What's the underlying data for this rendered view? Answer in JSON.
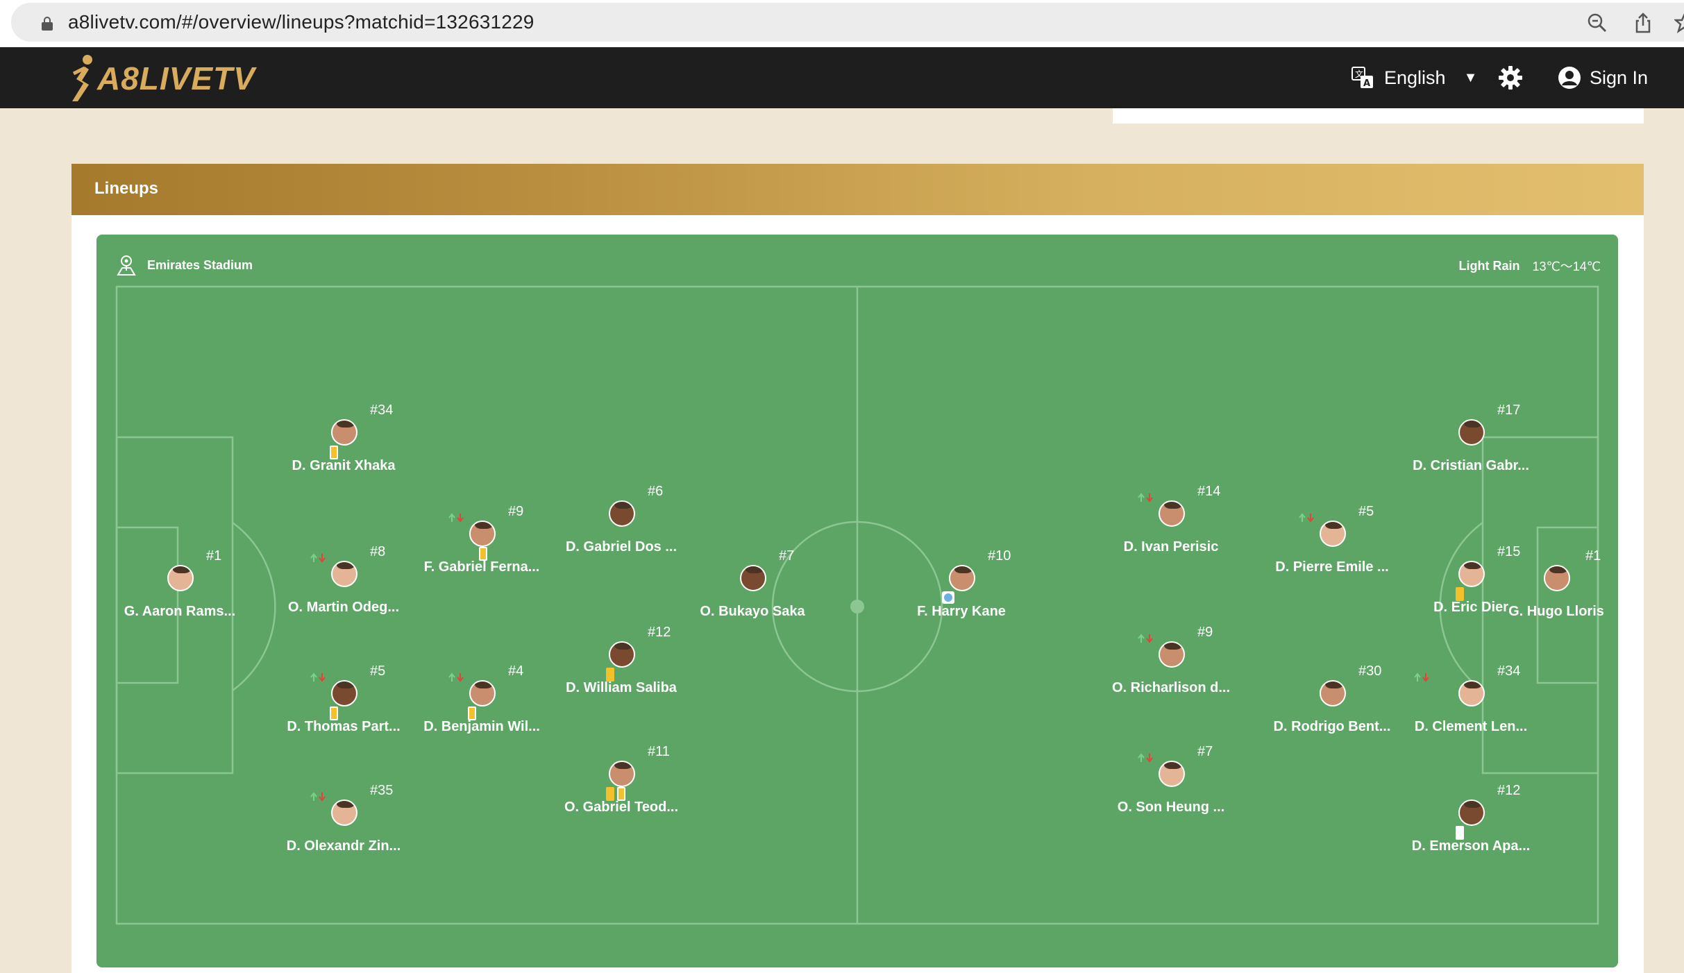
{
  "browser": {
    "url": "a8livetv.com/#/overview/lineups?matchid=132631229"
  },
  "header": {
    "logo_text": "A8LIVETV",
    "language": "English",
    "sign_in": "Sign In"
  },
  "lineups": {
    "title": "Lineups",
    "stadium": "Emirates Stadium",
    "weather": "Light Rain",
    "temperature": "13℃～14℃",
    "home_players": [
      {
        "num": "#1",
        "name": "G. Aaron Rams..."
      },
      {
        "num": "#34",
        "name": "D. Granit Xhaka"
      },
      {
        "num": "#8",
        "name": "O. Martin Odeg..."
      },
      {
        "num": "#5",
        "name": "D. Thomas Part..."
      },
      {
        "num": "#35",
        "name": "D. Olexandr Zin..."
      },
      {
        "num": "#9",
        "name": "F. Gabriel Ferna..."
      },
      {
        "num": "#4",
        "name": "D. Benjamin Wil..."
      },
      {
        "num": "#6",
        "name": "D. Gabriel Dos ..."
      },
      {
        "num": "#12",
        "name": "D. William Saliba"
      },
      {
        "num": "#11",
        "name": "O. Gabriel Teod..."
      },
      {
        "num": "#7",
        "name": "O. Bukayo Saka"
      }
    ],
    "away_players": [
      {
        "num": "#10",
        "name": "F. Harry Kane"
      },
      {
        "num": "#14",
        "name": "D. Ivan Perisic"
      },
      {
        "num": "#9",
        "name": "O. Richarlison d..."
      },
      {
        "num": "#7",
        "name": "O. Son Heung ..."
      },
      {
        "num": "#5",
        "name": "D. Pierre Emile ..."
      },
      {
        "num": "#30",
        "name": "D. Rodrigo Bent..."
      },
      {
        "num": "#17",
        "name": "D. Cristian Gabr..."
      },
      {
        "num": "#15",
        "name": "D. Eric Dier"
      },
      {
        "num": "#34",
        "name": "D. Clement Len..."
      },
      {
        "num": "#12",
        "name": "D. Emerson Apa..."
      },
      {
        "num": "#1",
        "name": "G. Hugo Lloris"
      }
    ]
  },
  "colors": {
    "pitch": "#5ca564",
    "header_bg": "#1e1e1e",
    "gold": "#d8ac5c",
    "yellow_card": "#f3c12b"
  }
}
